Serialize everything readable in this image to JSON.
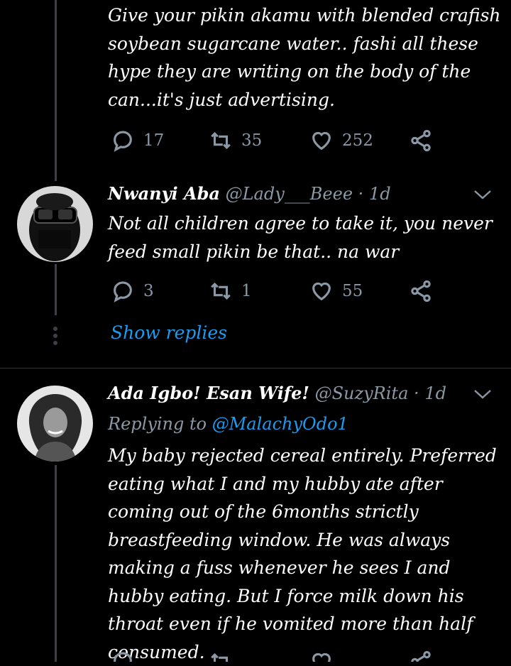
{
  "tweets": [
    {
      "text": "Give your pikin akamu with blended crafish soybean sugarcane water.. fashi all these hype they are writing on the body of the can...it's just advertising.",
      "replies": "17",
      "retweets": "35",
      "likes": "252"
    },
    {
      "name": "Nwanyi Aba",
      "handle": "@Lady___Beee",
      "separator": "·",
      "time": "1d",
      "text": "Not all children agree to take it, you never feed small pikin be that.. na war",
      "replies": "3",
      "retweets": "1",
      "likes": "55"
    },
    {
      "name": "Ada Igbo! Esan Wife!",
      "handle": "@SuzyRita",
      "separator": "·",
      "time": "1d",
      "replying_label": "Replying to",
      "replying_mention": "@MalachyOdo1",
      "text": "My baby rejected cereal entirely. Preferred eating what I and my hubby ate after coming out of the 6months strictly breastfeeding window. He was always making a fuss whenever he sees I and hubby eating. But I force milk down his throat even if he vomited more than half consumed."
    }
  ],
  "show_replies_label": "Show replies",
  "icons": {
    "reply": "reply-bubble-icon",
    "retweet": "retweet-icon",
    "like": "heart-icon",
    "share": "share-icon",
    "menu": "chevron-down-icon"
  },
  "colors": {
    "background": "#000000",
    "muted": "#8b98a5",
    "accent": "#1d9bf0",
    "thread_line": "#3d4147"
  }
}
